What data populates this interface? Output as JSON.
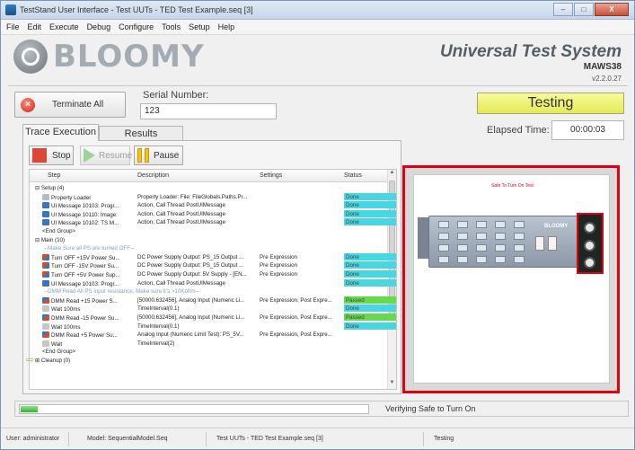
{
  "window": {
    "title": "TestStand User Interface - Test UUTs - TED Test Example.seq [3]",
    "controls": {
      "minimize": "–",
      "maximize": "□",
      "close": "X"
    }
  },
  "menu": [
    "File",
    "Edit",
    "Execute",
    "Debug",
    "Configure",
    "Tools",
    "Setup",
    "Help"
  ],
  "branding": {
    "logo_text": "BLOOMY",
    "system_title": "Universal Test System",
    "station": "MAWS38",
    "version": "v2.2.0.27"
  },
  "controls": {
    "terminate_label": "Terminate All",
    "serial_label": "Serial Number:",
    "serial_value": "123",
    "status": "Testing",
    "elapsed_label": "Elapsed Time:",
    "elapsed_value": "00:00:03"
  },
  "tabs": [
    {
      "label": "Trace Execution",
      "active": true
    },
    {
      "label": "Results",
      "active": false
    }
  ],
  "toolbar": {
    "stop": "Stop",
    "resume": "Resume",
    "pause": "Pause"
  },
  "grid": {
    "columns": [
      "Step",
      "Description",
      "Settings",
      "Status"
    ],
    "rows": [
      {
        "kind": "group",
        "step": "⊟ Setup (4)",
        "desc": "",
        "settings": "",
        "status": ""
      },
      {
        "kind": "prop",
        "step": "Property Loader",
        "desc": "Property Loader: File: FileGlobals.Paths.Pr...",
        "settings": "",
        "status": "Done"
      },
      {
        "kind": "msg",
        "step": "UI Message 10103: Progr...",
        "desc": "Action, Call Thread PostUIMessage",
        "settings": "",
        "status": "Done"
      },
      {
        "kind": "msg",
        "step": "UI Message 10110: Image:",
        "desc": "Action, Call Thread PostUIMessage",
        "settings": "",
        "status": "Done"
      },
      {
        "kind": "msg",
        "step": "UI Message 10102: TS M...",
        "desc": "Action, Call Thread PostUIMessage",
        "settings": "",
        "status": "Done"
      },
      {
        "kind": "plain",
        "step": "<End Group>",
        "desc": "",
        "settings": "",
        "status": ""
      },
      {
        "kind": "group",
        "step": "⊟ Main (10)",
        "desc": "",
        "settings": "",
        "status": ""
      },
      {
        "kind": "comment",
        "step": "--Make Sure all PS are turned OFF--",
        "desc": "",
        "settings": "",
        "status": ""
      },
      {
        "kind": "pwr",
        "step": "Turn OFF +15V Power Su...",
        "desc": "DC Power Supply Output: PS_15 Output ...",
        "settings": "Pre Expression",
        "status": "Done"
      },
      {
        "kind": "pwr",
        "step": "Turn OFF -15V Power Su...",
        "desc": "DC Power Supply Output: PS_15 Output ...",
        "settings": "Pre Expression",
        "status": "Done"
      },
      {
        "kind": "pwr",
        "step": "Turn OFF +5V Power Sup...",
        "desc": "DC Power Supply Output: 5V Supply - [EN...",
        "settings": "Pre Expression",
        "status": "Done"
      },
      {
        "kind": "msg",
        "step": "UI Message 10103: Progr...",
        "desc": "Action, Call Thread PostUIMessage",
        "settings": "",
        "status": "Done"
      },
      {
        "kind": "comment",
        "step": "--DMM Read All PS input resistance, Make sure it's >10Kohm--",
        "desc": "",
        "settings": "",
        "status": ""
      },
      {
        "kind": "dmm",
        "step": "DMM Read +15 Power S...",
        "desc": "[50000.632456], Analog Input (Numeric Li...",
        "settings": "Pre Expression, Post Expre...",
        "status": "Passed"
      },
      {
        "kind": "wait",
        "step": "Wait 100ms",
        "desc": "TimeInterval(0.1)",
        "settings": "",
        "status": "Done"
      },
      {
        "kind": "dmm",
        "step": "DMM Read -15 Power Su...",
        "desc": "[50000.632456], Analog Input (Numeric Li...",
        "settings": "Pre Expression, Post Expre...",
        "status": "Passed"
      },
      {
        "kind": "wait",
        "step": "Wait 100ms",
        "desc": "TimeInterval(0.1)",
        "settings": "",
        "status": "Done"
      },
      {
        "kind": "dmm",
        "step": "DMM Read +5 Power Su...",
        "desc": "Analog Input (Numeric Limit Test): PS_5V...",
        "settings": "Pre Expression, Post Expre...",
        "status": ""
      },
      {
        "kind": "wait",
        "step": "Wait",
        "desc": "TimeInterval(2)",
        "settings": "",
        "status": ""
      },
      {
        "kind": "plain",
        "step": "<End Group>",
        "desc": "",
        "settings": "",
        "status": ""
      },
      {
        "kind": "group",
        "step": "⊞ Cleanup (0)",
        "desc": "",
        "settings": "",
        "status": ""
      }
    ],
    "current_marker": "⇨"
  },
  "preview": {
    "title": "Safe To Turn On Test",
    "board_logo": "BLOOMY"
  },
  "progress": {
    "fraction": 0.05,
    "status_text": "Verifying Safe to Turn On"
  },
  "statusbar": {
    "user": "User: administrator",
    "model": "Model: SequentialModel.Seq",
    "sequence": "Test UUTs - TED Test Example.seq [3]",
    "state": "Testing"
  },
  "colors": {
    "status_done": "#47d6e2",
    "status_passed": "#66d94c",
    "highlight": "#e10010",
    "testing_bg": "#eef27a"
  }
}
